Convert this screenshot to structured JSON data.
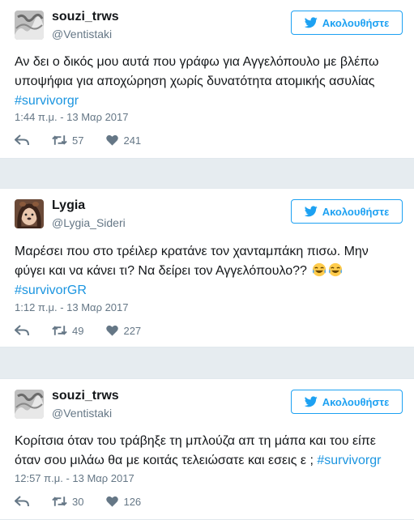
{
  "tweets": [
    {
      "name": "souzi_trws",
      "handle": "@Ventistaki",
      "follow_label": "Ακολουθήστε",
      "text": "Αν δει ο δικός μου αυτά που γράφω για Αγγελόπουλο με βλέπω υποψήφια για αποχώρηση χωρίς δυνατότητα ατομικής ασυλίας ",
      "hashtag": "#survivorgr",
      "time": "1:44 π.μ. - 13 Μαρ 2017",
      "retweets": "57",
      "likes": "241"
    },
    {
      "name": "Lygia",
      "handle": "@Lygia_Sideri",
      "follow_label": "Ακολουθήστε",
      "text": "Μαρέσει που στο τρέιλερ κρατάνε τον χανταμπάκη πισω. Μην φύγει και να κάνει τι? Να δείρει τον Αγγελόπουλο?? ",
      "emoji": "face-with-tears-of-joy",
      "hashtag": "#survivorGR",
      "time": "1:12 π.μ. - 13 Μαρ 2017",
      "retweets": "49",
      "likes": "227"
    },
    {
      "name": "souzi_trws",
      "handle": "@Ventistaki",
      "follow_label": "Ακολουθήστε",
      "text": "Κορίτσια όταν του τράβηξε τη μπλούζα απ τη μάπα και του είπε όταν σου μιλάω θα με κοιτάς τελειώσατε και εσεις ε ; ",
      "hashtag": "#survivorgr",
      "time": "12:57 π.μ. - 13 Μαρ 2017",
      "retweets": "30",
      "likes": "126"
    }
  ],
  "colors": {
    "accent": "#1da1f2",
    "hashtag": "#1b95e0",
    "muted": "#657786",
    "background": "#e6ecf0"
  },
  "icons": [
    "twitter-bird-icon",
    "reply-icon",
    "retweet-icon",
    "heart-icon"
  ]
}
